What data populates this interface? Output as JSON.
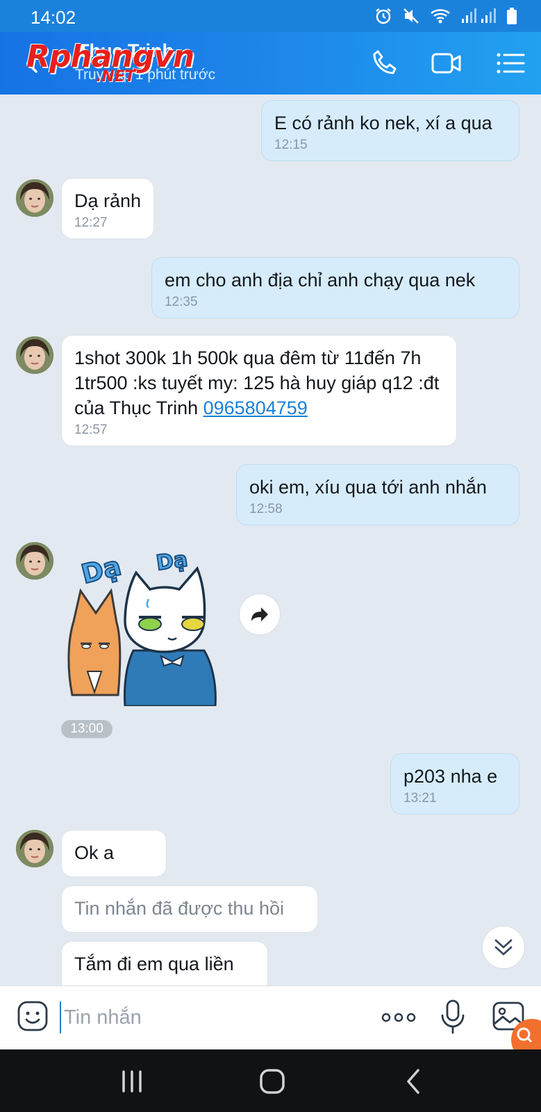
{
  "status_bar": {
    "time": "14:02"
  },
  "header": {
    "contact_name": "Thuc Trinh",
    "last_seen": "Truy cập 1 phút trước"
  },
  "watermark": {
    "main": "Rphangvn",
    "suffix": ".NET"
  },
  "messages": [
    {
      "direction": "out",
      "text": "E có rảnh ko nek, xí a qua",
      "time": "12:15"
    },
    {
      "direction": "in",
      "text": "Dạ rảnh",
      "time": "12:27"
    },
    {
      "direction": "out",
      "text": "em cho anh địa chỉ anh chạy qua nek",
      "time": "12:35"
    },
    {
      "direction": "in",
      "text": "1shot 300k 1h 500k qua đêm từ 11đến 7h 1tr500 :ks tuyết my: 125 hà huy giáp q12 :đt của Thục Trinh ",
      "link": "0965804759",
      "time": "12:57"
    },
    {
      "direction": "out",
      "text": "oki em, xíu qua tới anh nhắn",
      "time": "12:58"
    },
    {
      "direction": "in",
      "type": "sticker",
      "sticker_text_left": "Dạ",
      "sticker_text_right": "Dạ",
      "time": "13:00"
    },
    {
      "direction": "out",
      "text": "p203 nha e",
      "time": "13:21"
    },
    {
      "direction": "in",
      "text": "Ok a"
    },
    {
      "direction": "in",
      "text": "Tin nhắn đã được thu hồi",
      "recalled": true
    },
    {
      "direction": "in",
      "text": "Tắm đi em qua liền"
    }
  ],
  "input": {
    "placeholder": "Tin nhắn",
    "value": ""
  },
  "colors": {
    "header_start": "#1673e4",
    "header_end": "#22a1f0",
    "out_bubble": "#d6ecfb",
    "in_bubble": "#ffffff",
    "chat_bg": "#e2e9f1",
    "link": "#1a7fd6"
  },
  "icons": [
    "alarm-icon",
    "mute-icon",
    "wifi-icon",
    "signal-icon",
    "battery-icon",
    "back-icon",
    "phone-icon",
    "video-icon",
    "menu-icon",
    "forward-icon",
    "chevron-double-down-icon",
    "emoji-icon",
    "more-icon",
    "mic-icon",
    "image-icon",
    "recent-apps-icon",
    "home-icon",
    "nav-back-icon"
  ]
}
